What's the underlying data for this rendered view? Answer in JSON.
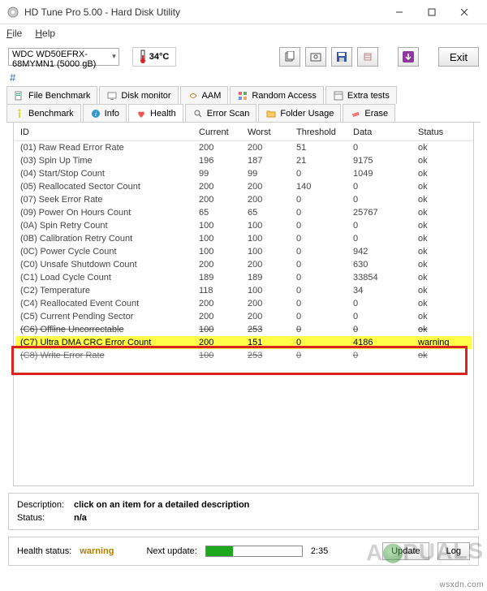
{
  "window": {
    "title": "HD Tune Pro 5.00 - Hard Disk Utility"
  },
  "menu": {
    "file": "File",
    "help": "Help"
  },
  "drive": {
    "name": "WDC WD50EFRX-68MYMN1 (5000 gB)"
  },
  "temp": {
    "value": "34°C"
  },
  "hash": "#",
  "buttons": {
    "exit": "Exit",
    "update": "Update",
    "log": "Log"
  },
  "tabs1": {
    "file_bench": "File Benchmark",
    "disk_monitor": "Disk monitor",
    "aam": "AAM",
    "random_access": "Random Access",
    "extra_tests": "Extra tests"
  },
  "tabs2": {
    "benchmark": "Benchmark",
    "info": "Info",
    "health": "Health",
    "error_scan": "Error Scan",
    "folder_usage": "Folder Usage",
    "erase": "Erase"
  },
  "table": {
    "headers": {
      "id": "ID",
      "current": "Current",
      "worst": "Worst",
      "threshold": "Threshold",
      "data": "Data",
      "status": "Status"
    },
    "rows": [
      {
        "id": "(01) Raw Read Error Rate",
        "current": "200",
        "worst": "200",
        "threshold": "51",
        "data": "0",
        "status": "ok"
      },
      {
        "id": "(03) Spin Up Time",
        "current": "196",
        "worst": "187",
        "threshold": "21",
        "data": "9175",
        "status": "ok"
      },
      {
        "id": "(04) Start/Stop Count",
        "current": "99",
        "worst": "99",
        "threshold": "0",
        "data": "1049",
        "status": "ok"
      },
      {
        "id": "(05) Reallocated Sector Count",
        "current": "200",
        "worst": "200",
        "threshold": "140",
        "data": "0",
        "status": "ok"
      },
      {
        "id": "(07) Seek Error Rate",
        "current": "200",
        "worst": "200",
        "threshold": "0",
        "data": "0",
        "status": "ok"
      },
      {
        "id": "(09) Power On Hours Count",
        "current": "65",
        "worst": "65",
        "threshold": "0",
        "data": "25767",
        "status": "ok"
      },
      {
        "id": "(0A) Spin Retry Count",
        "current": "100",
        "worst": "100",
        "threshold": "0",
        "data": "0",
        "status": "ok"
      },
      {
        "id": "(0B) Calibration Retry Count",
        "current": "100",
        "worst": "100",
        "threshold": "0",
        "data": "0",
        "status": "ok"
      },
      {
        "id": "(0C) Power Cycle Count",
        "current": "100",
        "worst": "100",
        "threshold": "0",
        "data": "942",
        "status": "ok"
      },
      {
        "id": "(C0) Unsafe Shutdown Count",
        "current": "200",
        "worst": "200",
        "threshold": "0",
        "data": "630",
        "status": "ok"
      },
      {
        "id": "(C1) Load Cycle Count",
        "current": "189",
        "worst": "189",
        "threshold": "0",
        "data": "33854",
        "status": "ok"
      },
      {
        "id": "(C2) Temperature",
        "current": "118",
        "worst": "100",
        "threshold": "0",
        "data": "34",
        "status": "ok"
      },
      {
        "id": "(C4) Reallocated Event Count",
        "current": "200",
        "worst": "200",
        "threshold": "0",
        "data": "0",
        "status": "ok"
      },
      {
        "id": "(C5) Current Pending Sector",
        "current": "200",
        "worst": "200",
        "threshold": "0",
        "data": "0",
        "status": "ok"
      },
      {
        "id": "(C6) Offline Uncorrectable",
        "current": "100",
        "worst": "253",
        "threshold": "0",
        "data": "0",
        "status": "ok",
        "strike": true
      },
      {
        "id": "(C7) Ultra DMA CRC Error Count",
        "current": "200",
        "worst": "151",
        "threshold": "0",
        "data": "4186",
        "status": "warning",
        "highlight": true
      },
      {
        "id": "(C8) Write Error Rate",
        "current": "100",
        "worst": "253",
        "threshold": "0",
        "data": "0",
        "status": "ok",
        "strike": true,
        "dim": true
      }
    ]
  },
  "desc": {
    "description_label": "Description:",
    "description_value": "click on an item for a detailed description",
    "status_label": "Status:",
    "status_value": "n/a"
  },
  "status": {
    "health_label": "Health status:",
    "health_value": "warning",
    "next_update_label": "Next update:",
    "time": "2:35"
  },
  "watermark": {
    "text_pre": "A",
    "text_post": "PUALS"
  },
  "site": "wsxdn.com"
}
